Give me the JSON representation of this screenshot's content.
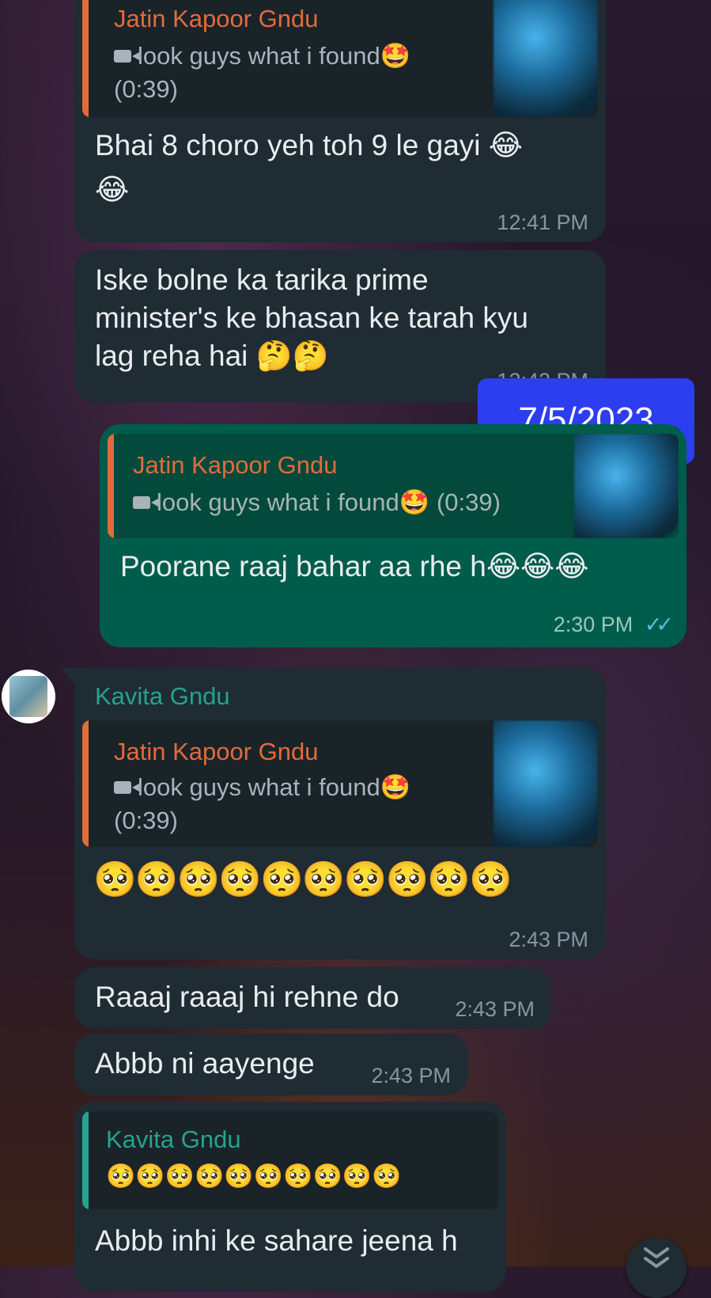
{
  "messages": {
    "m1": {
      "quote_sender": "Jatin Kapoor Gndu",
      "quote_text": "look guys what i found🤩",
      "quote_duration": "(0:39)",
      "text": "Bhai 8 choro yeh toh 9 le gayi 😂",
      "text2": "😂",
      "time": "12:41 PM"
    },
    "m2": {
      "line1": "Iske bolne ka tarika prime",
      "line2": "minister's ke bhasan ke tarah kyu",
      "line3": "lag reha hai 🤔🤔",
      "time": "12:42 PM"
    },
    "date_badge": "7/5/2023",
    "m3": {
      "quote_sender": "Jatin Kapoor Gndu",
      "quote_text": "look guys what i found🤩 (0:39)",
      "text": "Poorane raaj bahar aa rhe h😂😂😂",
      "time": "2:30 PM",
      "ticks": "✓✓"
    },
    "m4": {
      "sender": "Kavita Gndu",
      "quote_sender": "Jatin Kapoor Gndu",
      "quote_text": "look guys what i found🤩",
      "quote_duration": "(0:39)",
      "text": "🥺🥺🥺🥺🥺🥺🥺🥺🥺🥺",
      "time": "2:43 PM"
    },
    "m5": {
      "text": "Raaaj raaaj hi rehne do",
      "time": "2:43 PM"
    },
    "m6": {
      "text": "Abbb ni aayenge",
      "time": "2:43 PM"
    },
    "m7": {
      "quote_sender": "Kavita Gndu",
      "quote_text": "🥺🥺🥺🥺🥺🥺🥺🥺🥺🥺",
      "text": "Abbb inhi ke sahare jeena h"
    }
  },
  "colors": {
    "incoming_bubble": "#1f2c33",
    "outgoing_bubble": "#005c4b",
    "quote_name_orange": "#e26b3a",
    "quote_name_teal": "#25a38e",
    "sender_name": "#25a38e",
    "date_badge": "#2c3ef0",
    "ticks": "#53bdeb"
  },
  "icons": {
    "scroll_down": "double-chevron-down-icon",
    "video": "video-camera-icon"
  }
}
